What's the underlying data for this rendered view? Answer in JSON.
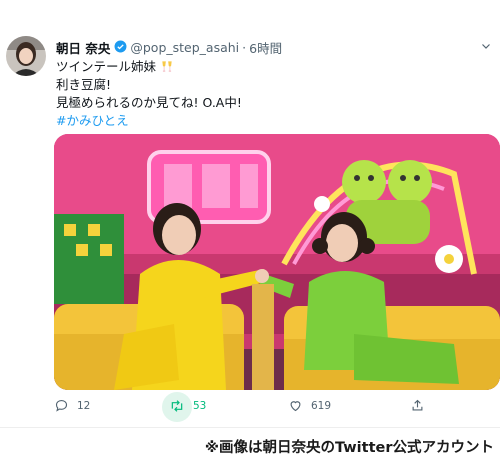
{
  "tweet": {
    "display_name": "朝日 奈央",
    "handle": "@pop_step_asahi",
    "separator": "·",
    "time": "6時間",
    "lines": [
      "ツインテール姉妹",
      "利き豆腐!",
      "見極められるのか見てね! O.A中!"
    ],
    "emoji_icon": "cheers-glasses-icon",
    "hashtag": "#かみひとえ"
  },
  "actions": {
    "reply_count": "12",
    "retweet_count": "53",
    "like_count": "619"
  },
  "colors": {
    "accent": "#1d9bf0",
    "retweet_active": "#00ba7c",
    "muted": "#536471"
  },
  "footer": {
    "caption": "※画像は朝日奈央のTwitter公式アカウント"
  }
}
